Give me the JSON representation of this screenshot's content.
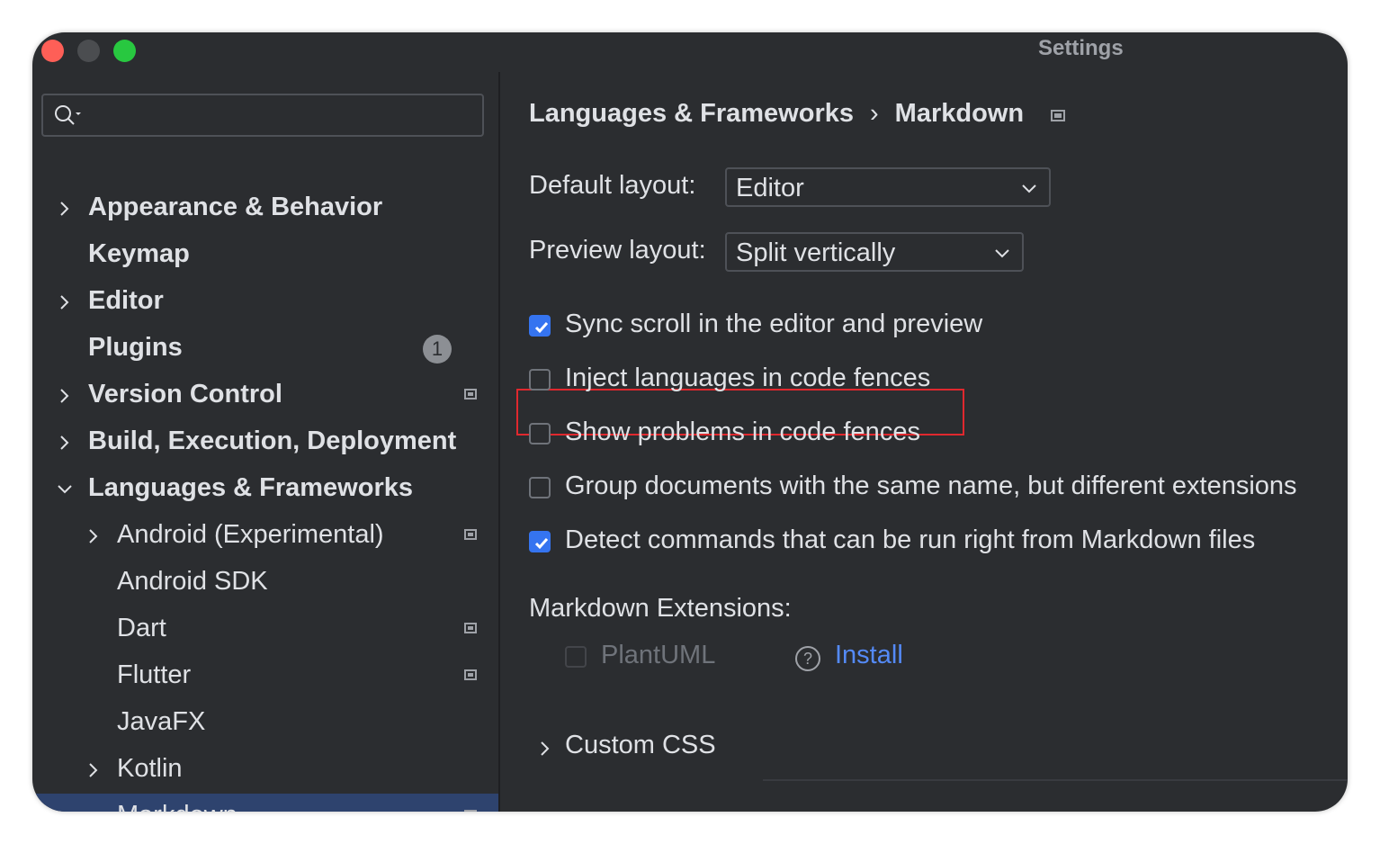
{
  "window": {
    "title": "Settings"
  },
  "sidebar": {
    "search_placeholder": "",
    "items": [
      {
        "label": "Appearance & Behavior",
        "expandable": true,
        "expanded": false,
        "bold": true
      },
      {
        "label": "Keymap",
        "expandable": false,
        "bold": true
      },
      {
        "label": "Editor",
        "expandable": true,
        "expanded": false,
        "bold": true
      },
      {
        "label": "Plugins",
        "expandable": false,
        "bold": true,
        "badge": "1"
      },
      {
        "label": "Version Control",
        "expandable": true,
        "expanded": false,
        "bold": true,
        "project_icon": true
      },
      {
        "label": "Build, Execution, Deployment",
        "expandable": true,
        "expanded": false,
        "bold": true
      },
      {
        "label": "Languages & Frameworks",
        "expandable": true,
        "expanded": true,
        "bold": true
      },
      {
        "label": "Android (Experimental)",
        "expandable": true,
        "expanded": false,
        "project_icon": true
      },
      {
        "label": "Android SDK",
        "expandable": false
      },
      {
        "label": "Dart",
        "expandable": false,
        "project_icon": true
      },
      {
        "label": "Flutter",
        "expandable": false,
        "project_icon": true
      },
      {
        "label": "JavaFX",
        "expandable": false
      },
      {
        "label": "Kotlin",
        "expandable": true,
        "expanded": false
      },
      {
        "label": "Markdown",
        "expandable": false,
        "selected": true,
        "project_icon": true
      }
    ]
  },
  "main": {
    "breadcrumb": {
      "parent": "Languages & Frameworks",
      "separator": "›",
      "current": "Markdown"
    },
    "default_layout": {
      "label": "Default layout:",
      "value": "Editor"
    },
    "preview_layout": {
      "label": "Preview layout:",
      "value": "Split vertically"
    },
    "options": [
      {
        "label": "Sync scroll in the editor and preview",
        "checked": true
      },
      {
        "label": "Inject languages in code fences",
        "checked": false,
        "highlighted": true
      },
      {
        "label": "Show problems in code fences",
        "checked": false
      },
      {
        "label": "Group documents with the same name, but different extensions",
        "checked": false
      },
      {
        "label": "Detect commands that can be run right from Markdown files",
        "checked": true
      }
    ],
    "extensions": {
      "heading": "Markdown Extensions:",
      "plantuml": {
        "label": "PlantUML",
        "checked": false,
        "enabled": false,
        "help": "?",
        "action": "Install"
      }
    },
    "custom_css": {
      "label": "Custom CSS",
      "chevron": "›"
    }
  },
  "colors": {
    "background": "#2b2d30",
    "selection": "#2e436e",
    "accent": "#3574f0",
    "link": "#548af7",
    "highlight_border": "#e0282e"
  }
}
